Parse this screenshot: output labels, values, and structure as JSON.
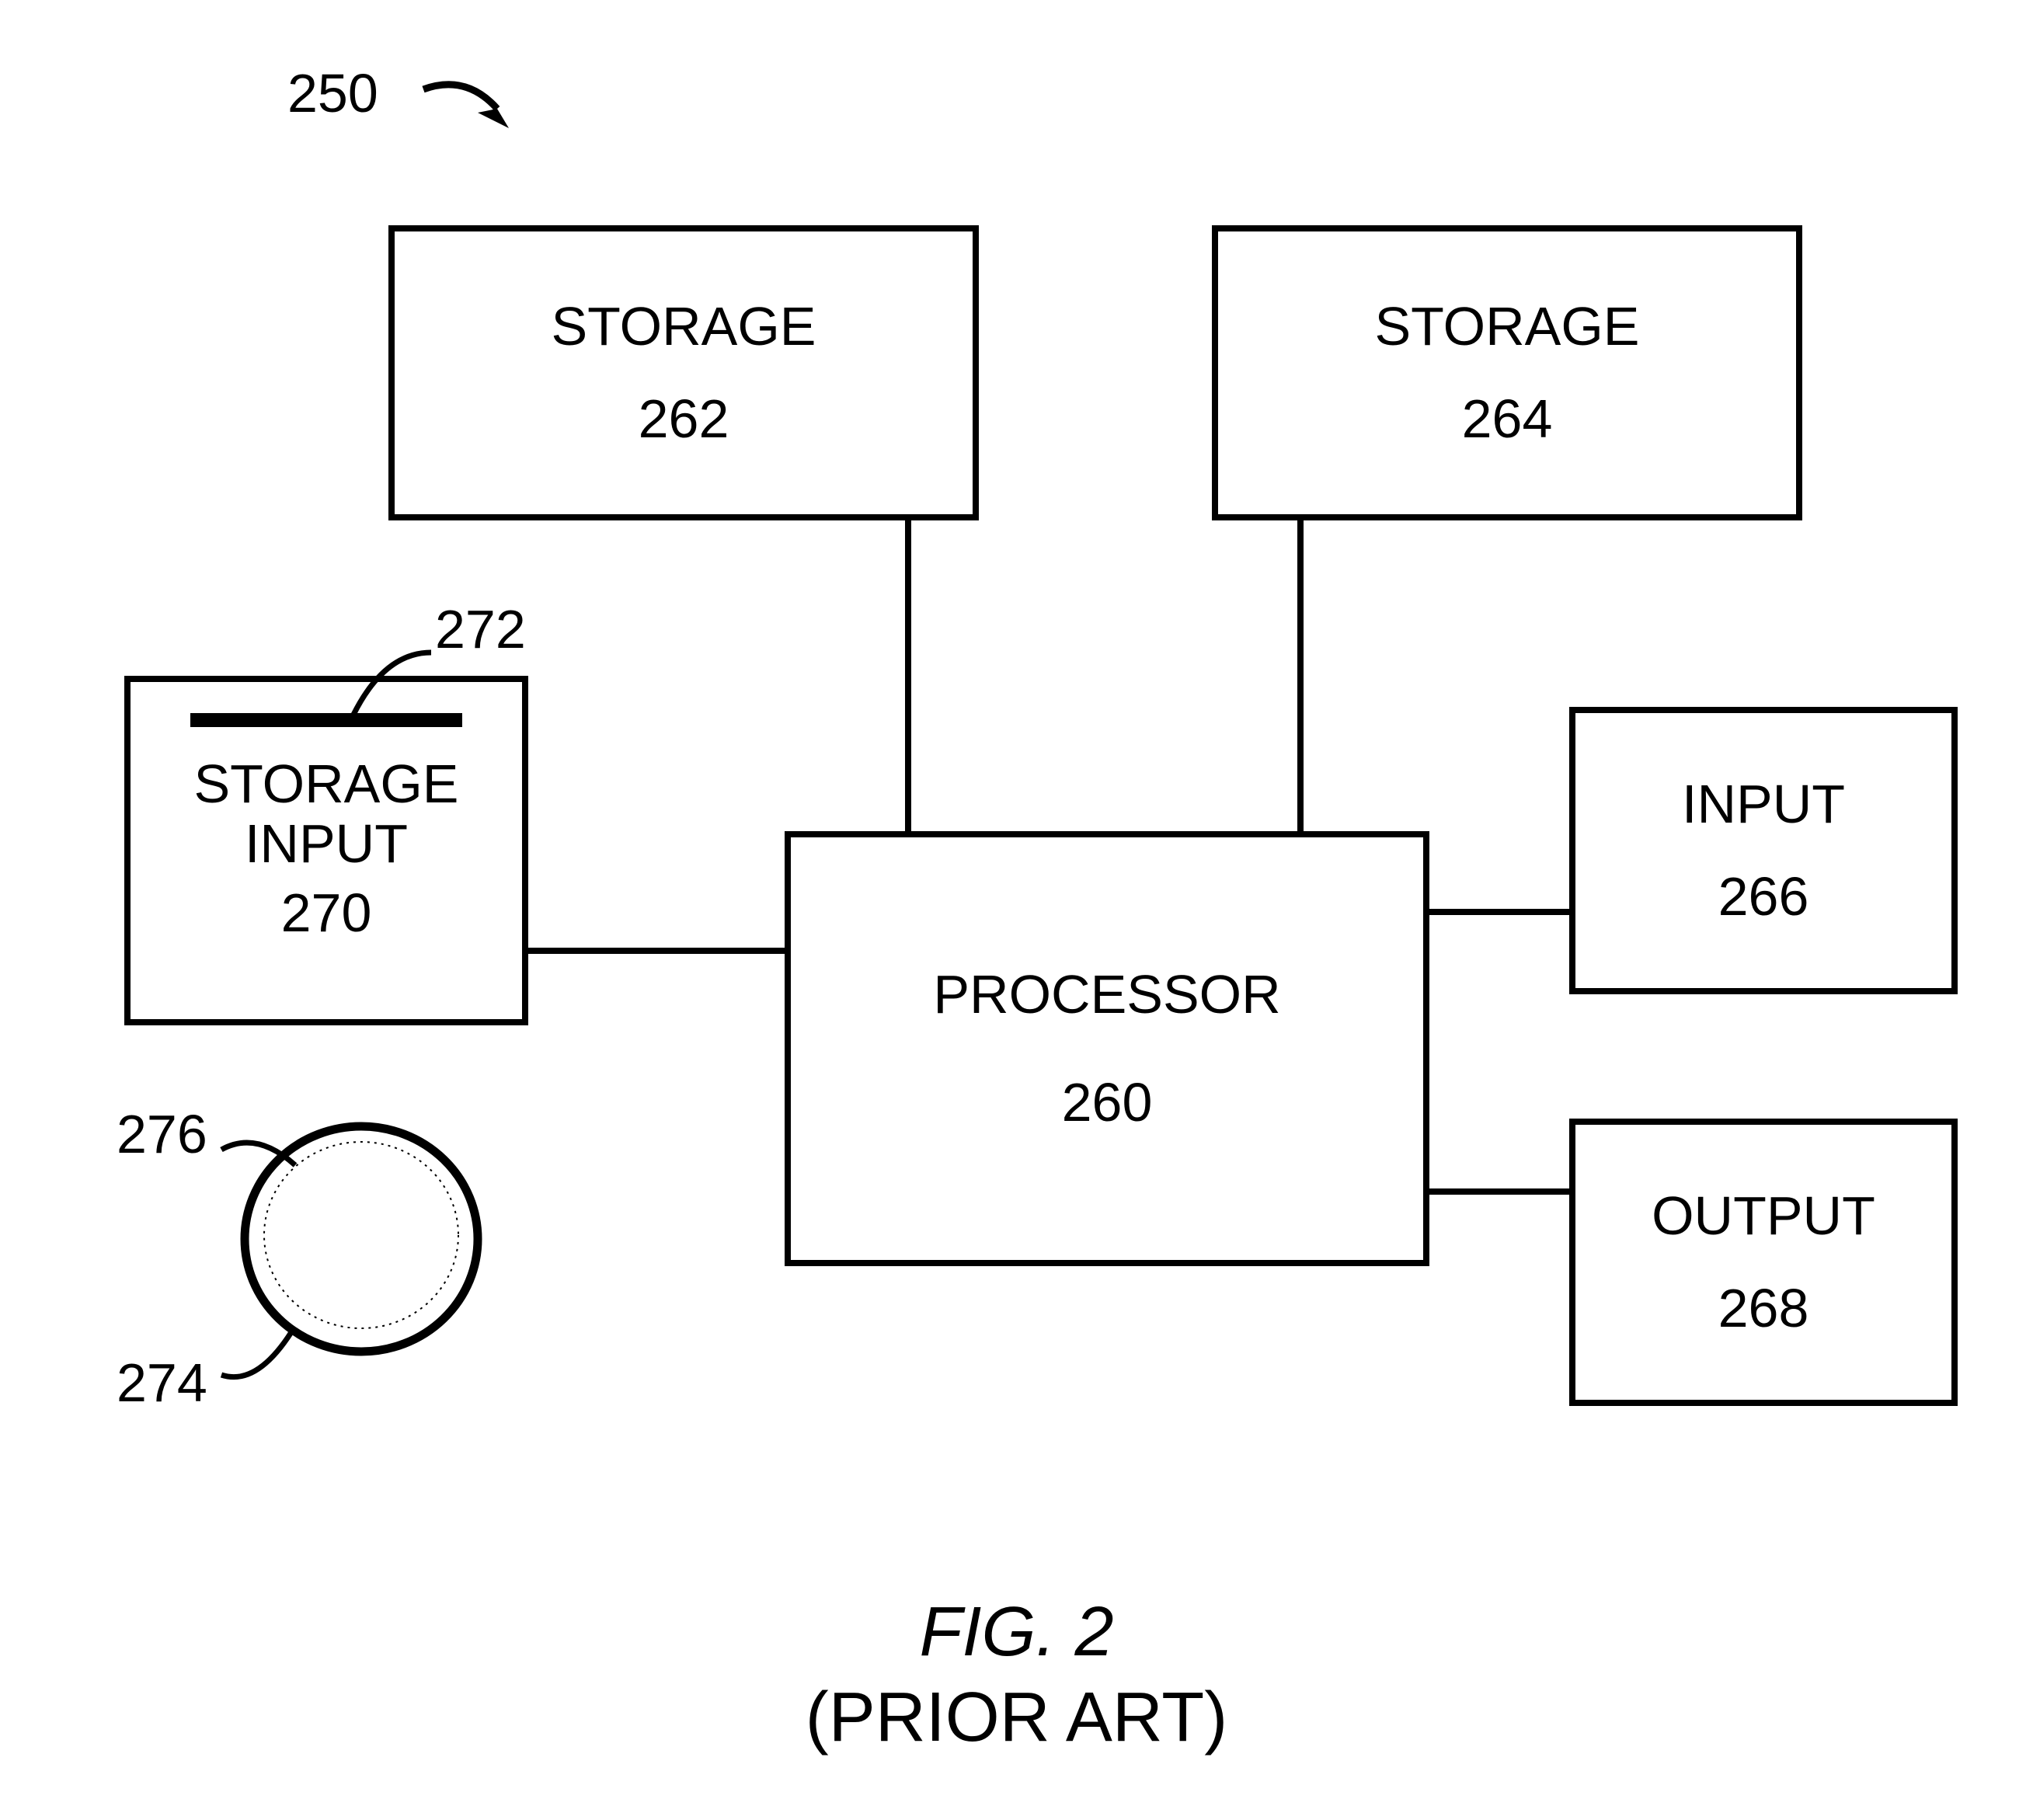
{
  "refs": {
    "top": "250",
    "slot": "272",
    "disc_outer": "274",
    "disc_inner": "276"
  },
  "boxes": {
    "storage_left": {
      "label": "STORAGE",
      "num": "262"
    },
    "storage_right": {
      "label": "STORAGE",
      "num": "264"
    },
    "storage_input": {
      "label": "STORAGE\nINPUT",
      "num": "270"
    },
    "processor": {
      "label": "PROCESSOR",
      "num": "260"
    },
    "input": {
      "label": "INPUT",
      "num": "266"
    },
    "output": {
      "label": "OUTPUT",
      "num": "268"
    }
  },
  "caption": {
    "title": "FIG. 2",
    "sub": "(PRIOR ART)"
  }
}
